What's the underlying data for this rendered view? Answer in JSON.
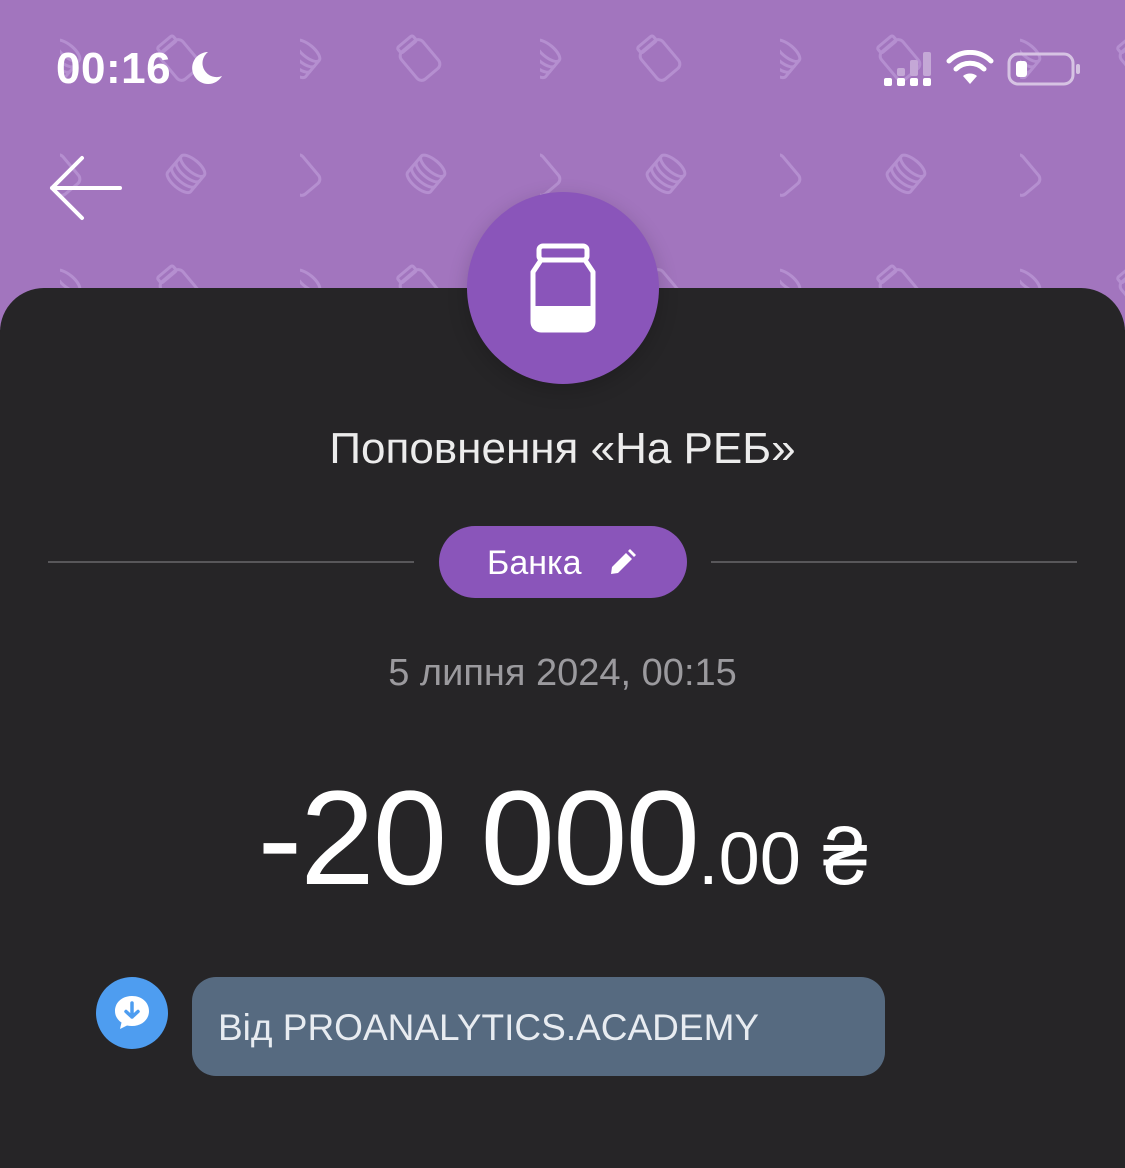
{
  "status_bar": {
    "time": "00:16"
  },
  "transaction": {
    "title": "Поповнення «На РЕБ»",
    "category": "Банка",
    "datetime": "5 липня 2024, 00:15",
    "amount_main": "-20 000",
    "amount_cents": ".00",
    "currency": "₴",
    "comment": "Від PROANALYTICS.ACADEMY"
  },
  "colors": {
    "header": "#a275be",
    "accent": "#8a55ba",
    "card_background": "#262527",
    "comment_bubble": "#566a80",
    "comment_icon": "#4e9df0"
  },
  "icons": {
    "back": "arrow-left-icon",
    "avatar": "jar-icon",
    "category": "pencil-icon",
    "comment": "message-download-icon"
  }
}
